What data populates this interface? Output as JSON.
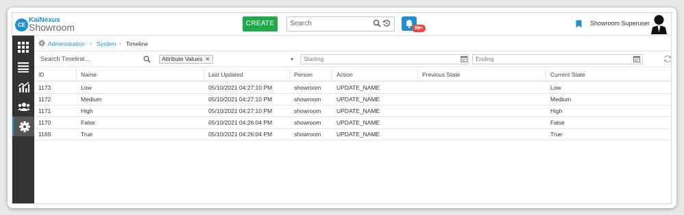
{
  "header": {
    "logo_top": "KaiNexus",
    "logo_bottom": "Showroom",
    "logo_badge": "CE",
    "create_label": "CREATE",
    "search_placeholder": "Search",
    "notification_badge": "99+",
    "user_name": "Showroom Superuser"
  },
  "sidebar": {
    "items": [
      {
        "name": "apps-grid-icon"
      },
      {
        "name": "list-icon"
      },
      {
        "name": "analytics-icon"
      },
      {
        "name": "people-icon"
      },
      {
        "name": "settings-gear-icon",
        "active": true
      }
    ]
  },
  "breadcrumb": {
    "items": [
      "Administration",
      "System"
    ],
    "separator": "›",
    "current": "Timeline"
  },
  "filters": {
    "search_placeholder": "Search Timeline...",
    "tag_label": "Attribute Values",
    "tag_remove": "✕",
    "dropdown_caret": "▾",
    "start_placeholder": "Starting",
    "end_placeholder": "Ending"
  },
  "table": {
    "columns": [
      "ID",
      "Name",
      "Last Updated",
      "Person",
      "Action",
      "Previous State",
      "Current State"
    ],
    "rows": [
      [
        "1173",
        "Low",
        "05/10/2021 04:27:10 PM",
        "showroom",
        "UPDATE_NAME",
        "",
        "Low"
      ],
      [
        "1172",
        "Medium",
        "05/10/2021 04:27:10 PM",
        "showroom",
        "UPDATE_NAME",
        "",
        "Medium"
      ],
      [
        "1171",
        "High",
        "05/10/2021 04:27:10 PM",
        "showroom",
        "UPDATE_NAME",
        "",
        "High"
      ],
      [
        "1170",
        "False",
        "05/10/2021 04:26:04 PM",
        "showroom",
        "UPDATE_NAME",
        "",
        "False"
      ],
      [
        "1169",
        "True",
        "05/10/2021 04:26:04 PM",
        "showroom",
        "UPDATE_NAME",
        "",
        "True"
      ]
    ]
  },
  "colors": {
    "brand_blue": "#1e8fd1",
    "create_green": "#21a84a",
    "badge_red": "#e24c3e",
    "sidebar_bg": "#333333"
  }
}
